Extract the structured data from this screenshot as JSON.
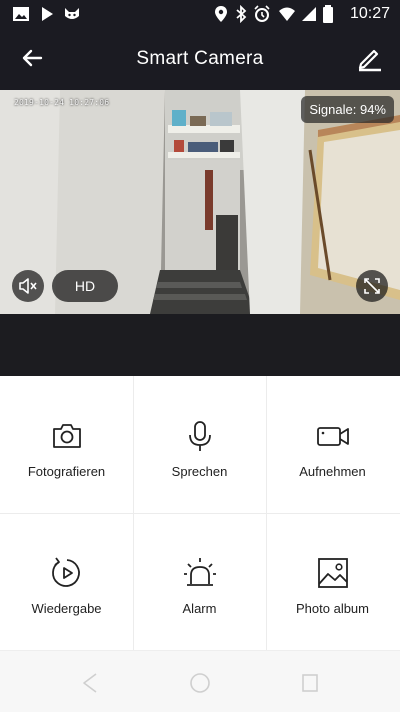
{
  "status_bar": {
    "time": "10:27",
    "icons": [
      "image-icon",
      "play-icon",
      "cat-icon",
      "location-icon",
      "bluetooth-icon",
      "alarm-clock-icon",
      "wifi-icon",
      "signal-icon",
      "battery-icon"
    ]
  },
  "app_bar": {
    "title": "Smart  Camera",
    "back_icon": "arrow-left-icon",
    "edit_icon": "pencil-icon"
  },
  "video": {
    "timestamp": "2019-10-24 10:27:06",
    "signal_label": "Signale: 94%",
    "quality_label": "HD",
    "mute_icon": "speaker-muted-icon",
    "fullscreen_icon": "fullscreen-icon"
  },
  "actions": [
    {
      "label": "Fotografieren",
      "icon": "camera-icon"
    },
    {
      "label": "Sprechen",
      "icon": "microphone-icon"
    },
    {
      "label": "Aufnehmen",
      "icon": "video-camera-icon"
    },
    {
      "label": "Wiedergabe",
      "icon": "replay-icon"
    },
    {
      "label": "Alarm",
      "icon": "siren-icon"
    },
    {
      "label": "Photo album",
      "icon": "image-icon"
    }
  ],
  "colors": {
    "dark": "#1b1b22",
    "grid_bg": "#ffffff",
    "text": "#222222"
  }
}
